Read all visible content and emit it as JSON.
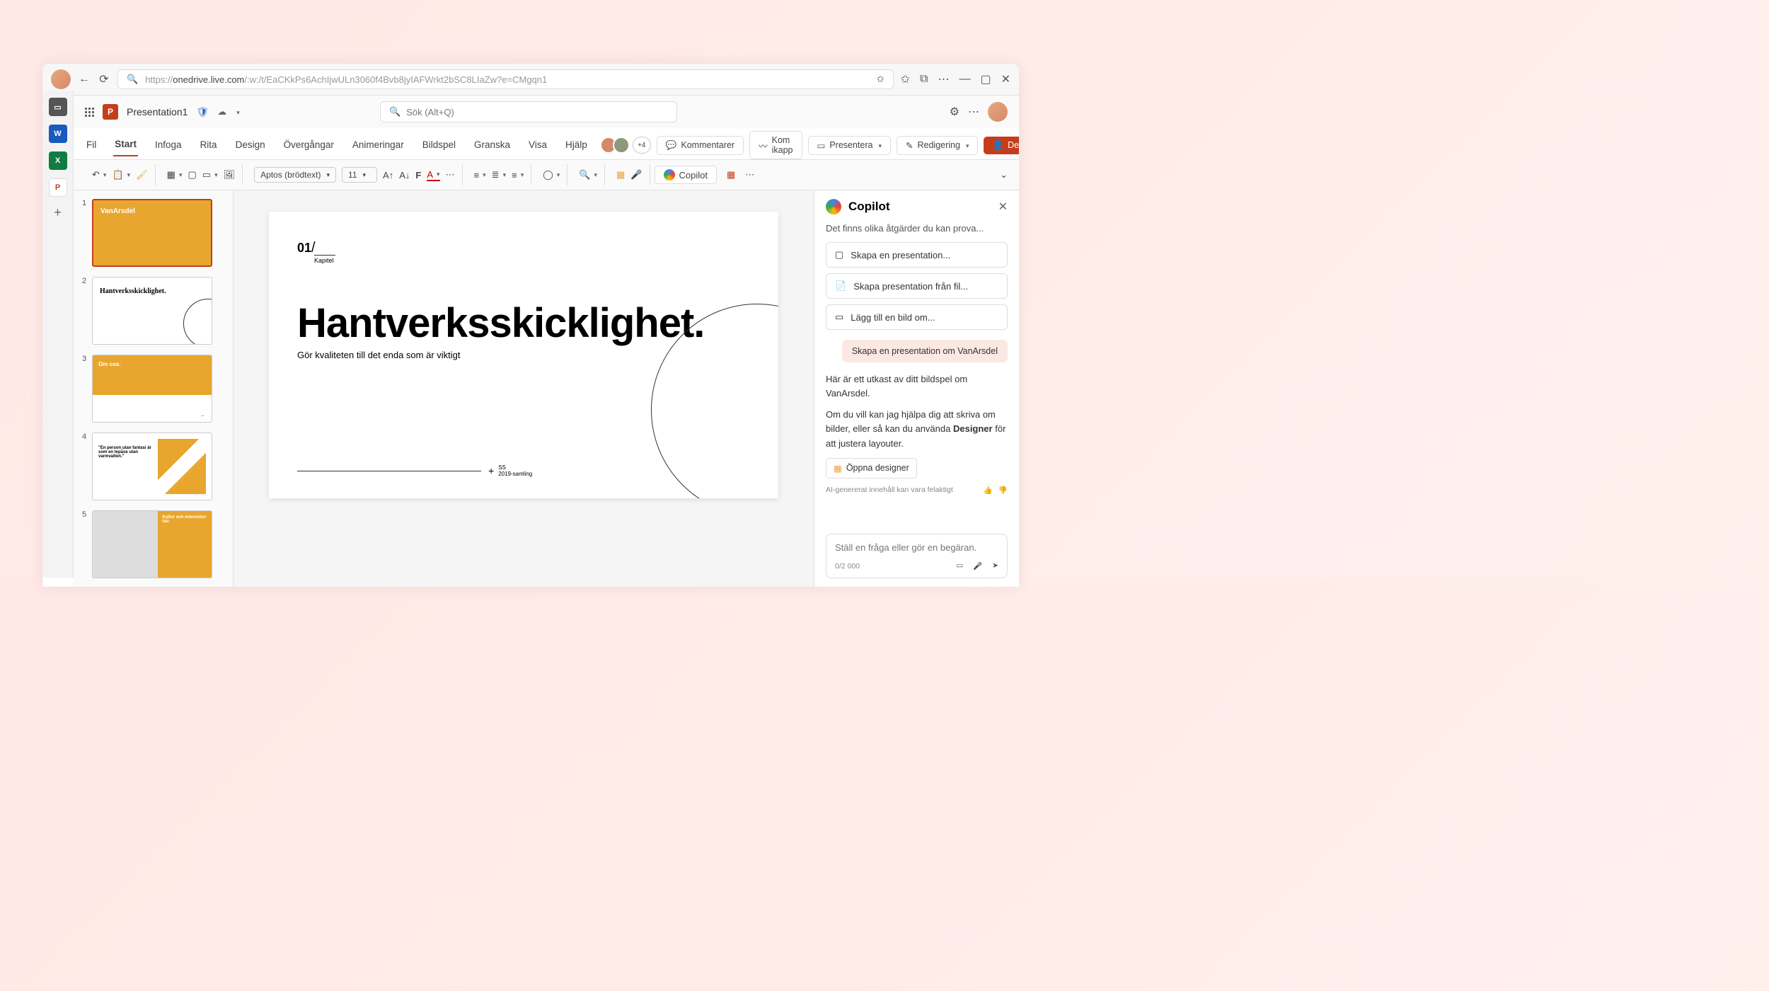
{
  "browser": {
    "url_prefix": "https://",
    "url_host": "onedrive.live.com",
    "url_path": "/:w:/t/EaCKkPs6AchIjwULn3060f4Bvb8jyIAFWrkt2bSC8LIaZw?e=CMgqn1"
  },
  "app": {
    "doc_title": "Presentation1",
    "search_placeholder": "Sök (Alt+Q)"
  },
  "tabs": {
    "fil": "Fil",
    "start": "Start",
    "infoga": "Infoga",
    "rita": "Rita",
    "design": "Design",
    "overgangar": "Övergångar",
    "animeringar": "Animeringar",
    "bildspel": "Bildspel",
    "granska": "Granska",
    "visa": "Visa",
    "hjalp": "Hjälp"
  },
  "ribbon_right": {
    "people_count": "+4",
    "kommentarer": "Kommentarer",
    "kom_ikapp": "Kom ikapp",
    "presentera": "Presentera",
    "redigering": "Redigering",
    "dela": "Dela"
  },
  "toolbar": {
    "font_name": "Aptos (brödtext)",
    "font_size": "11",
    "copilot_label": "Copilot"
  },
  "slide": {
    "num": "01",
    "kapitel": "Kapitel",
    "heading": "Hantverksskicklighet.",
    "subheading": "Gör kvaliteten till det enda som är viktigt",
    "footer_ss": "SS",
    "footer_coll": "2019-samling"
  },
  "thumbs": {
    "t1_brand": "VanArsdel",
    "t2_title": "Hantverksskicklighet.",
    "t3_title": "Om oss.",
    "t4_quote": "\"En person utan fantasi är som en tepåse utan varmvatten.\"",
    "t5_title": "Kultur och människor här."
  },
  "copilot": {
    "title": "Copilot",
    "intro": "Det finns olika åtgärder du kan prova...",
    "s1": "Skapa en presentation...",
    "s2": "Skapa presentation från fil...",
    "s3": "Lägg till en bild om...",
    "user_msg": "Skapa en presentation om VanArsdel",
    "resp1": "Här är ett utkast av ditt bildspel om VanArsdel.",
    "resp2a": "Om du vill kan jag hjälpa dig att skriva om bilder, eller så kan du använda ",
    "resp2b": "Designer",
    "resp2c": " för att justera layouter.",
    "open_designer": "Öppna designer",
    "disclaimer": "AI-genererat innehåll kan vara felaktigt",
    "input_placeholder": "Ställ en fråga eller gör en begäran.",
    "counter": "0/2 000"
  }
}
